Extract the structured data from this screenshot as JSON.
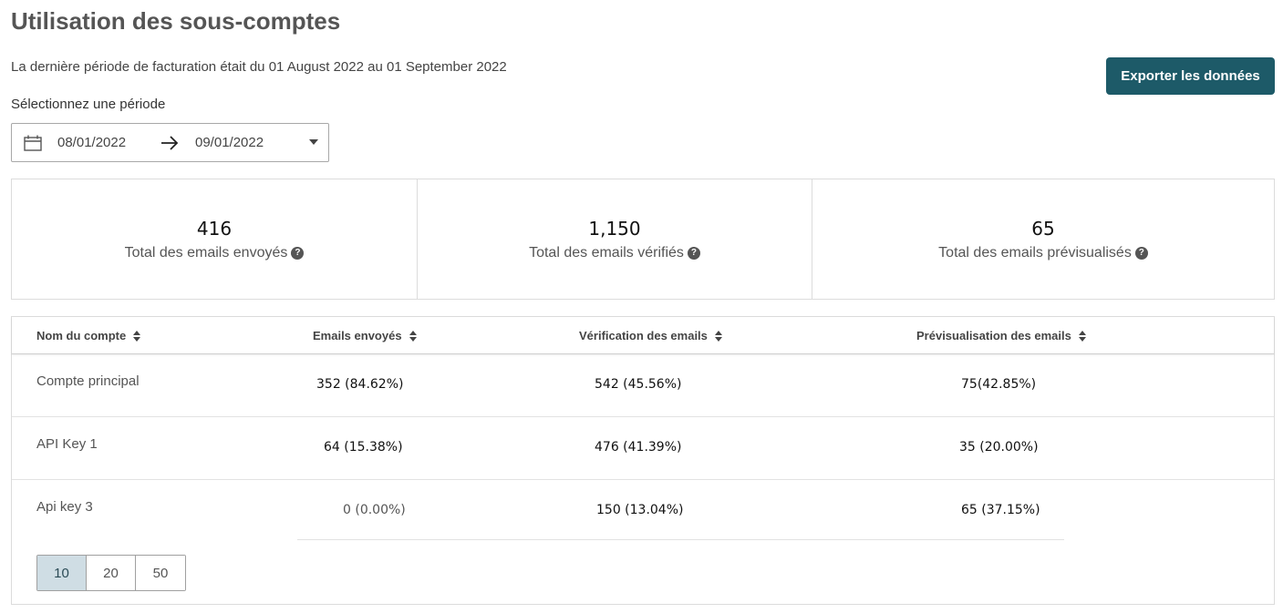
{
  "page": {
    "title": "Utilisation des sous-comptes",
    "billing_text": "La dernière période de facturation était du 01 August 2022 au 01 September 2022",
    "export_label": "Exporter les données",
    "period_label": "Sélectionnez une période"
  },
  "date_range": {
    "start": "08/01/2022",
    "end": "09/01/2022"
  },
  "stats": [
    {
      "value": "416",
      "label": "Total des emails envoyés"
    },
    {
      "value": "1,150",
      "label": "Total des emails vérifiés"
    },
    {
      "value": "65",
      "label": "Total des emails prévisualisés"
    }
  ],
  "table": {
    "headers": [
      "Nom du compte",
      "Emails envoyés",
      "Vérification des emails",
      "Prévisualisation des emails"
    ],
    "rows": [
      {
        "name": "Compte principal",
        "sent": "352 (84.62%)",
        "verified": "542 (45.56%)",
        "preview": "75(42.85%)"
      },
      {
        "name": "API Key 1",
        "sent": "64 (15.38%)",
        "verified": "476 (41.39%)",
        "preview": "35 (20.00%)"
      },
      {
        "name": "Api key 3",
        "sent": "0 (0.00%)",
        "verified": "150 (13.04%)",
        "preview": "65 (37.15%)"
      }
    ]
  },
  "pagination": {
    "options": [
      "10",
      "20",
      "50"
    ],
    "selected": "10"
  }
}
